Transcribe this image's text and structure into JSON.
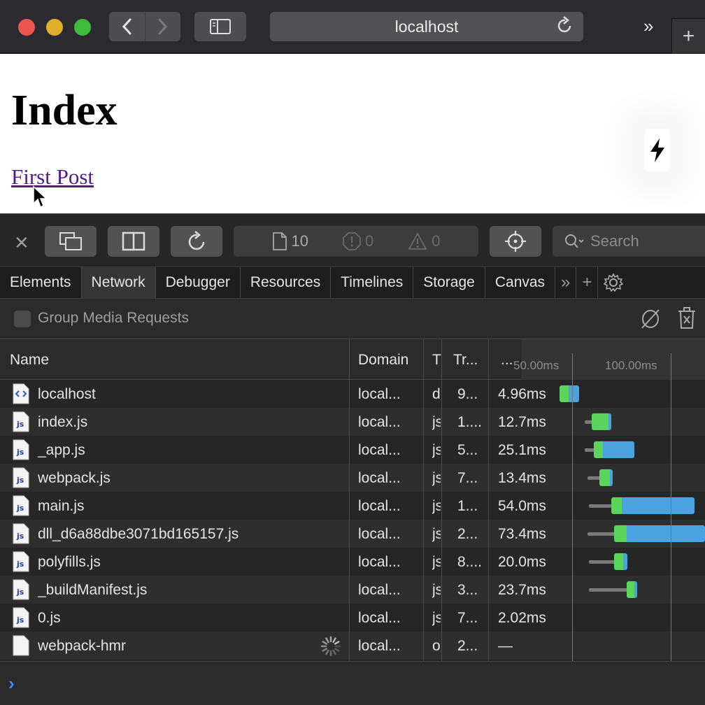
{
  "browser": {
    "address": "localhost",
    "chevrons": "»",
    "new_tab": "+"
  },
  "page": {
    "heading": "Index",
    "link": "First Post"
  },
  "devtools": {
    "counts": {
      "resources": "10",
      "errors": "0",
      "warnings": "0"
    },
    "search_placeholder": "Search",
    "tabs": [
      "Elements",
      "Network",
      "Debugger",
      "Resources",
      "Timelines",
      "Storage",
      "Canvas"
    ],
    "active_tab": "Network",
    "group_media_label": "Group Media Requests",
    "columns": {
      "name": "Name",
      "domain": "Domain",
      "type": "T",
      "transferred": "Tr...",
      "time": "..."
    },
    "timeline_ticks": [
      "50.00ms",
      "100.00ms"
    ],
    "requests": [
      {
        "name": "localhost",
        "icon": "html-icon",
        "domain": "local...",
        "type": "d",
        "transferred": "9...",
        "time": "4.96ms"
      },
      {
        "name": "index.js",
        "icon": "js-icon",
        "domain": "local...",
        "type": "js",
        "transferred": "1....",
        "time": "12.7ms"
      },
      {
        "name": "_app.js",
        "icon": "js-icon",
        "domain": "local...",
        "type": "js",
        "transferred": "5...",
        "time": "25.1ms"
      },
      {
        "name": "webpack.js",
        "icon": "js-icon",
        "domain": "local...",
        "type": "js",
        "transferred": "7...",
        "time": "13.4ms"
      },
      {
        "name": "main.js",
        "icon": "js-icon",
        "domain": "local...",
        "type": "js",
        "transferred": "1...",
        "time": "54.0ms"
      },
      {
        "name": "dll_d6a88dbe3071bd165157.js",
        "icon": "js-icon",
        "domain": "local...",
        "type": "js",
        "transferred": "2...",
        "time": "73.4ms"
      },
      {
        "name": "polyfills.js",
        "icon": "js-icon",
        "domain": "local...",
        "type": "js",
        "transferred": "8....",
        "time": "20.0ms"
      },
      {
        "name": "_buildManifest.js",
        "icon": "js-icon",
        "domain": "local...",
        "type": "js",
        "transferred": "3...",
        "time": "23.7ms"
      },
      {
        "name": "0.js",
        "icon": "js-icon",
        "domain": "local...",
        "type": "js",
        "transferred": "7...",
        "time": "2.02ms"
      },
      {
        "name": "webpack-hmr",
        "icon": "file-icon",
        "domain": "local...",
        "type": "o",
        "transferred": "2...",
        "time": "—"
      }
    ],
    "colors": {
      "waiting": "#5bd45c",
      "download": "#4aa3df",
      "link": "#551a8b",
      "console_prompt": "#3a8cff"
    }
  }
}
